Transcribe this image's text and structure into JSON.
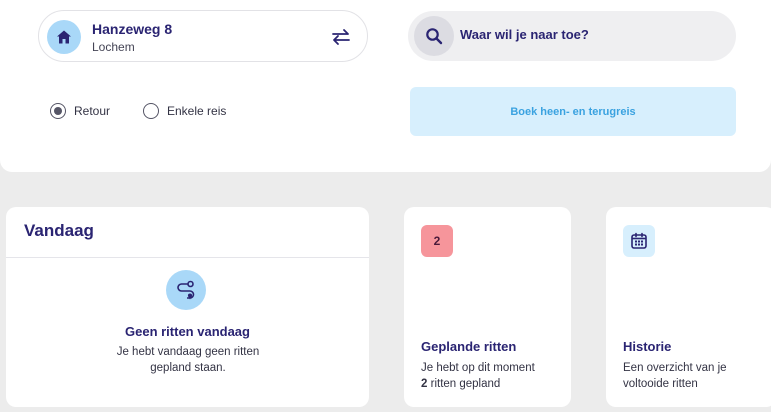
{
  "trip": {
    "from": {
      "title": "Hanzeweg 8",
      "city": "Lochem",
      "icon": "home-icon"
    },
    "swap_icon": "swap-arrows-icon",
    "search": {
      "icon": "search-icon",
      "placeholder": "Waar wil je naar toe?"
    },
    "options": [
      {
        "label": "Retour",
        "checked": true
      },
      {
        "label": "Enkele reis",
        "checked": false
      }
    ],
    "book_label": "Boek heen- en terugreis"
  },
  "today": {
    "title": "Vandaag",
    "icon": "route-icon",
    "empty_title": "Geen ritten vandaag",
    "empty_text": "Je hebt vandaag geen ritten gepland staan."
  },
  "planned": {
    "count": "2",
    "title": "Geplande ritten",
    "text_prefix": "Je hebt op dit moment",
    "count_bold": "2",
    "text_suffix": "ritten gepland"
  },
  "history": {
    "icon": "calendar-icon",
    "title": "Historie",
    "text": "Een overzicht van je voltooide ritten"
  },
  "colors": {
    "brand_text": "#2a2472",
    "light_blue": "#a9d8f8",
    "button_bg": "#d7effd",
    "button_text": "#3aa2e0",
    "badge_red": "#f6959b",
    "page_bg": "#ececec"
  }
}
